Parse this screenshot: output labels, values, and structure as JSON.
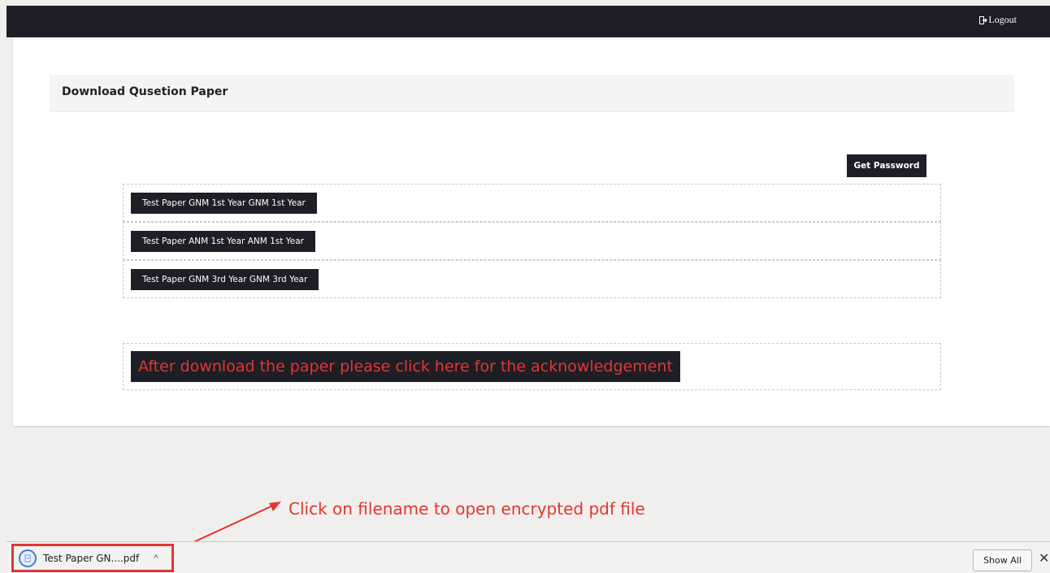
{
  "header": {
    "logout_label": "Logout",
    "logout_icon": "sign-out-icon"
  },
  "panel": {
    "title": "Download Qusetion Paper"
  },
  "actions": {
    "get_password_label": "Get Password"
  },
  "papers": [
    {
      "label": "Test Paper GNM 1st Year GNM 1st Year"
    },
    {
      "label": "Test Paper ANM 1st Year ANM 1st Year"
    },
    {
      "label": "Test Paper GNM 3rd Year GNM 3rd Year"
    }
  ],
  "acknowledgement": {
    "label": "After download the paper please click here for the acknowledgement",
    "color": "#e2362f"
  },
  "annotation": {
    "text": "Click on filename to open encrypted pdf file",
    "color": "#e2362f"
  },
  "download_bar": {
    "file_name": "Test Paper GN....pdf",
    "file_icon": "pdf-file-icon",
    "show_all_label": "Show All",
    "close_icon": "close-icon"
  },
  "colors": {
    "dark": "#1d1e26",
    "accent_red": "#e2362f"
  }
}
